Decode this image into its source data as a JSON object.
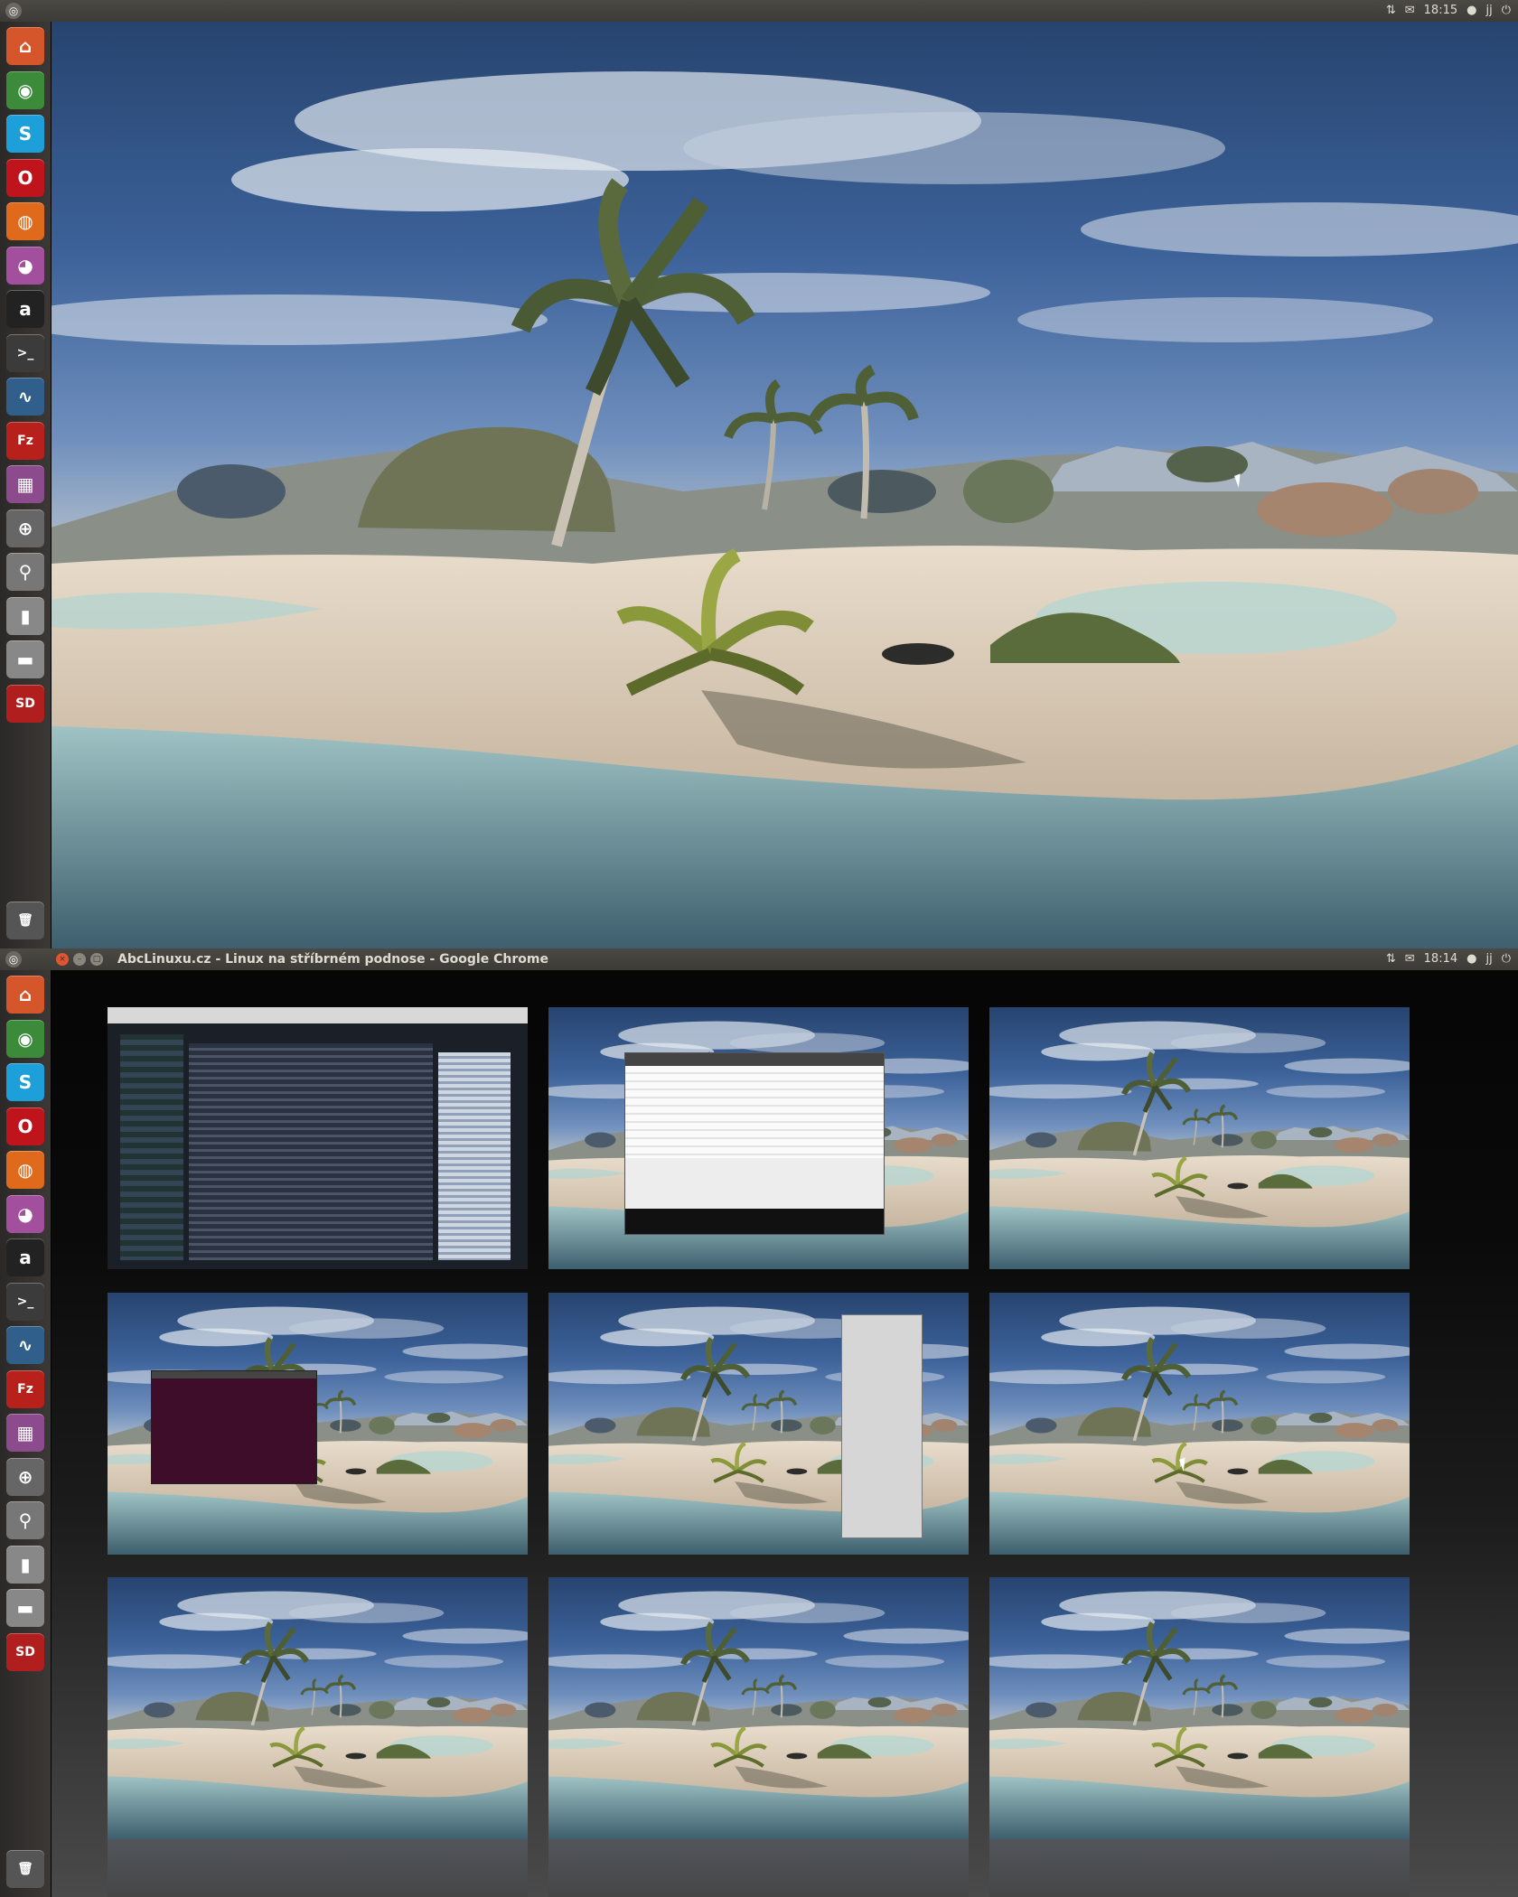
{
  "screen1": {
    "panel": {
      "time": "18:15",
      "user": "jj"
    }
  },
  "screen2": {
    "panel": {
      "time": "18:14",
      "user": "jj",
      "window_title": "AbcLinuxu.cz - Linux na stříbrném podnose - Google Chrome"
    }
  },
  "launcher": {
    "items": [
      {
        "name": "home-folder",
        "glyph": "⌂",
        "color": "#d5562a"
      },
      {
        "name": "chrome",
        "glyph": "◉",
        "color": "#3c8b3a"
      },
      {
        "name": "skype",
        "glyph": "S",
        "color": "#1d9fd9"
      },
      {
        "name": "opera",
        "glyph": "O",
        "color": "#c0141c"
      },
      {
        "name": "firefox",
        "glyph": "◍",
        "color": "#e06a1c"
      },
      {
        "name": "pidgin",
        "glyph": "◕",
        "color": "#a24f9d"
      },
      {
        "name": "amazon",
        "glyph": "a",
        "color": "#222222"
      },
      {
        "name": "terminal",
        "glyph": ">_",
        "color": "#3b3b3b"
      },
      {
        "name": "system-monitor",
        "glyph": "∿",
        "color": "#2f5f8a"
      },
      {
        "name": "filezilla",
        "glyph": "Fz",
        "color": "#b8211b"
      },
      {
        "name": "workspace-switcher",
        "glyph": "▦",
        "color": "#8b4b8c"
      },
      {
        "name": "magnifier",
        "glyph": "⊕",
        "color": "#666666"
      },
      {
        "name": "dash-search",
        "glyph": "⚲",
        "color": "#777777"
      },
      {
        "name": "usb-drive",
        "glyph": "▮",
        "color": "#888888"
      },
      {
        "name": "drive",
        "glyph": "▬",
        "color": "#888888"
      },
      {
        "name": "sd-card",
        "glyph": "SD",
        "color": "#b01e1e"
      },
      {
        "name": "trash",
        "glyph": "🗑",
        "color": "#555555"
      }
    ]
  },
  "workspaces": [
    {
      "content": "browser"
    },
    {
      "content": "file-window"
    },
    {
      "content": "empty"
    },
    {
      "content": "terminal"
    },
    {
      "content": "tall-window"
    },
    {
      "content": "empty-cursor"
    },
    {
      "content": "empty"
    },
    {
      "content": "empty"
    },
    {
      "content": "empty"
    }
  ]
}
